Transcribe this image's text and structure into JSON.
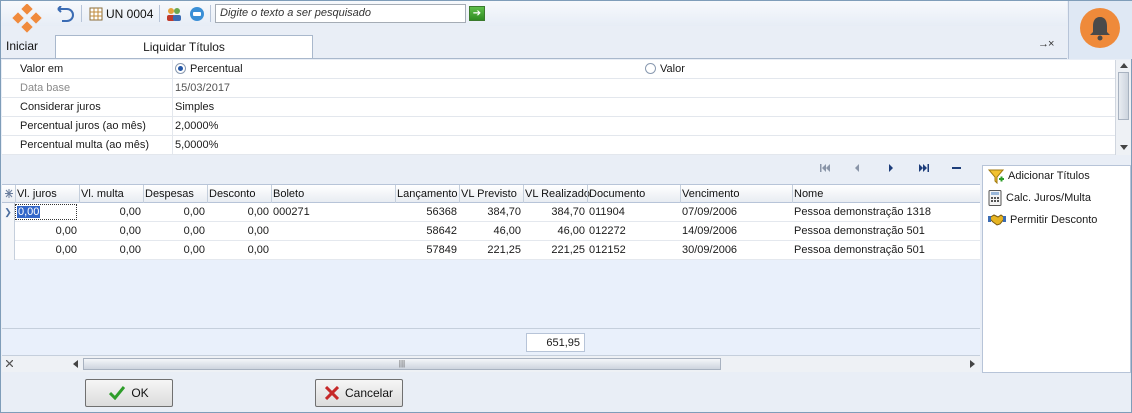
{
  "toolbar": {
    "unit_label": "UN 0004",
    "search_placeholder": "Digite o texto a ser pesquisado"
  },
  "home_label": "Iniciar",
  "tab_title": "Liquidar Títulos",
  "close_glyph": "→×",
  "properties": {
    "valor_em": {
      "label": "Valor em",
      "options": [
        "Percentual",
        "Valor"
      ],
      "selected": "Percentual"
    },
    "rows": [
      {
        "label": "Data base",
        "value": "15/03/2017",
        "disabled": true
      },
      {
        "label": "Considerar juros",
        "value": "Simples"
      },
      {
        "label": "Percentual juros (ao mês)",
        "value": "2,0000%"
      },
      {
        "label": "Percentual multa (ao mês)",
        "value": "5,0000%"
      }
    ]
  },
  "grid": {
    "columns": [
      "Vl. juros",
      "Vl. multa",
      "Despesas",
      "Desconto",
      "Boleto",
      "Lançamento",
      "VL Previsto",
      "VL Realizado",
      "Documento",
      "Vencimento",
      "Nome"
    ],
    "rows": [
      [
        "0,00",
        "0,00",
        "0,00",
        "0,00",
        "000271",
        "56368",
        "384,70",
        "384,70",
        "011904",
        "07/09/2006",
        "Pessoa demonstração 1318"
      ],
      [
        "0,00",
        "0,00",
        "0,00",
        "0,00",
        "",
        "58642",
        "46,00",
        "46,00",
        "012272",
        "14/09/2006",
        "Pessoa demonstração 501"
      ],
      [
        "0,00",
        "0,00",
        "0,00",
        "0,00",
        "",
        "57849",
        "221,25",
        "221,25",
        "012152",
        "30/09/2006",
        "Pessoa demonstração 501"
      ]
    ],
    "total_vl_realizado": "651,95",
    "scroll_grip": "|||"
  },
  "side_actions": [
    {
      "label": "Adicionar Títulos",
      "icon": "funnel-add-icon"
    },
    {
      "label": "Calc. Juros/Multa",
      "icon": "calculator-icon"
    },
    {
      "label": "Permitir Desconto",
      "icon": "handshake-icon"
    }
  ],
  "buttons": {
    "ok": "OK",
    "cancel": "Cancelar"
  },
  "colors": {
    "accent": "#2457a6",
    "bell": "#ef8a3a",
    "ok_check": "#2e9d2a",
    "cancel_x": "#c62828"
  }
}
